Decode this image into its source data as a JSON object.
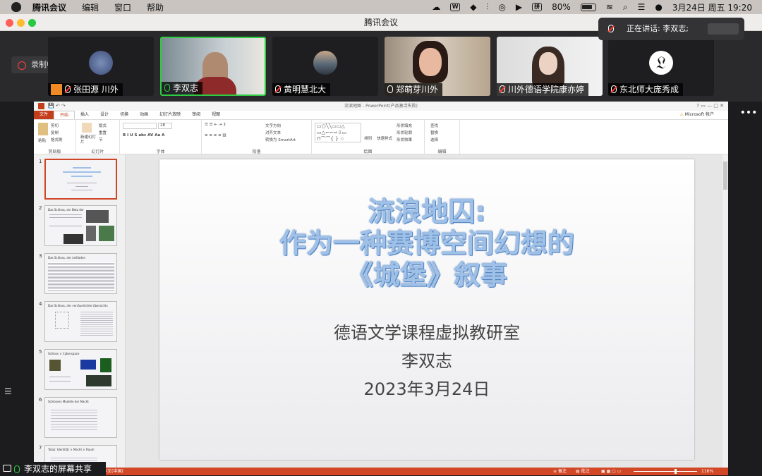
{
  "menubar": {
    "app": "腾讯会议",
    "items": [
      "编辑",
      "窗口",
      "帮助"
    ],
    "ime": "拼",
    "battery": "80%",
    "datetime": "3月24日 周五  19:20"
  },
  "window": {
    "title": "腾讯会议"
  },
  "recording": {
    "label": "录制中"
  },
  "speaking": {
    "label": "正在讲话: 李双志;"
  },
  "participants": [
    {
      "name": "张田源 川外"
    },
    {
      "name": "李双志"
    },
    {
      "name": "黄明慧北大"
    },
    {
      "name": "郑萌芽川外"
    },
    {
      "name": "川外德语学院康亦婷"
    },
    {
      "name": "东北师大庞秀成"
    }
  ],
  "ppt": {
    "window_title": "流浪地图 - PowerPoint(产品激活失败)",
    "tabs": [
      "文件",
      "开始",
      "插入",
      "设计",
      "切换",
      "动画",
      "幻灯片放映",
      "审阅",
      "视图"
    ],
    "account": "Microsoft 帐户",
    "ribbon": {
      "clipboard": {
        "paste": "粘贴",
        "cut": "剪切",
        "copy": "复制",
        "format": "格式刷",
        "label": "剪贴板"
      },
      "slides": {
        "new": "新建幻灯片",
        "layout": "版式",
        "reset": "重置",
        "section": "节",
        "label": "幻灯片"
      },
      "font": {
        "size": "28",
        "label": "字体"
      },
      "paragraph": {
        "dir": "文字方向",
        "align": "对齐文本",
        "smartart": "转换为 SmartArt",
        "label": "段落"
      },
      "drawing": {
        "arrange": "排列",
        "quick": "快速样式",
        "fill": "形状填充",
        "outline": "形状轮廓",
        "effect": "形状效果",
        "label": "绘图"
      },
      "editing": {
        "find": "查找",
        "replace": "替换",
        "select": "选择",
        "label": "编辑"
      }
    },
    "thumb_numbers": [
      "1",
      "2",
      "3",
      "4",
      "5",
      "6",
      "7"
    ],
    "thumb_titles": [
      "",
      "Das Schloss, ein Netz der",
      "Das Schloss, der Leitfaden",
      "Das Schloss, der verräumlichte Ubersichts",
      "Schloss × Cyberspace",
      "Schlosses Modelle der Macht",
      "Totaz: Identität × Macht × Raum"
    ],
    "status_lang": "中文(中国)",
    "status_notes": "备注",
    "status_comments": "批注",
    "zoom": "116%"
  },
  "slide": {
    "title_lines": [
      "流浪地囚:",
      "作为一种赛博空间幻想的",
      "《城堡》叙事"
    ],
    "subtitle": "德语文学课程虚拟教研室",
    "author": "李双志",
    "date": "2023年3月24日"
  },
  "share": {
    "label": "李双志的屏幕共享"
  }
}
